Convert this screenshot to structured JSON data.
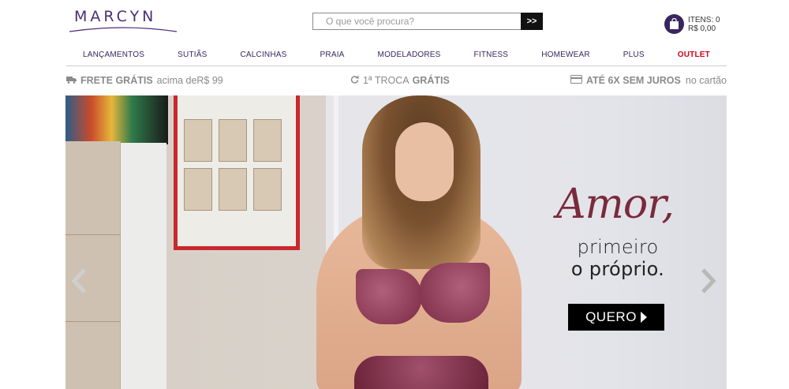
{
  "brand": {
    "name": "MARCYN",
    "color": "#4b2f7a"
  },
  "search": {
    "placeholder": "O que você procura?",
    "button_label": ">>"
  },
  "cart": {
    "items_label": "ITENS: 0",
    "total_label": "R$ 0,00"
  },
  "nav": {
    "items": [
      {
        "label": "LANÇAMENTOS"
      },
      {
        "label": "SUTIÃS"
      },
      {
        "label": "CALCINHAS"
      },
      {
        "label": "PRAIA"
      },
      {
        "label": "MODELADORES"
      },
      {
        "label": "FITNESS"
      },
      {
        "label": "HOMEWEAR"
      },
      {
        "label": "PLUS"
      },
      {
        "label": "OUTLET",
        "color": "#d0021b"
      }
    ]
  },
  "benefits": {
    "shipping": {
      "bold": "FRETE GRÁTIS",
      "rest": "acima de",
      "value": "R$ 99",
      "icon": "truck-icon"
    },
    "exchange": {
      "prefix": "1ª TROCA",
      "bold": "GRÁTIS",
      "icon": "refresh-icon"
    },
    "installments": {
      "bold": "ATÉ 6X SEM JUROS",
      "rest": "no cartão",
      "icon": "credit-card-icon"
    }
  },
  "banner": {
    "headline_script": "Amor,",
    "line2": "primeiro",
    "line3": "o próprio.",
    "cta_label": "QUERO",
    "accent": "#7a2a3c"
  }
}
